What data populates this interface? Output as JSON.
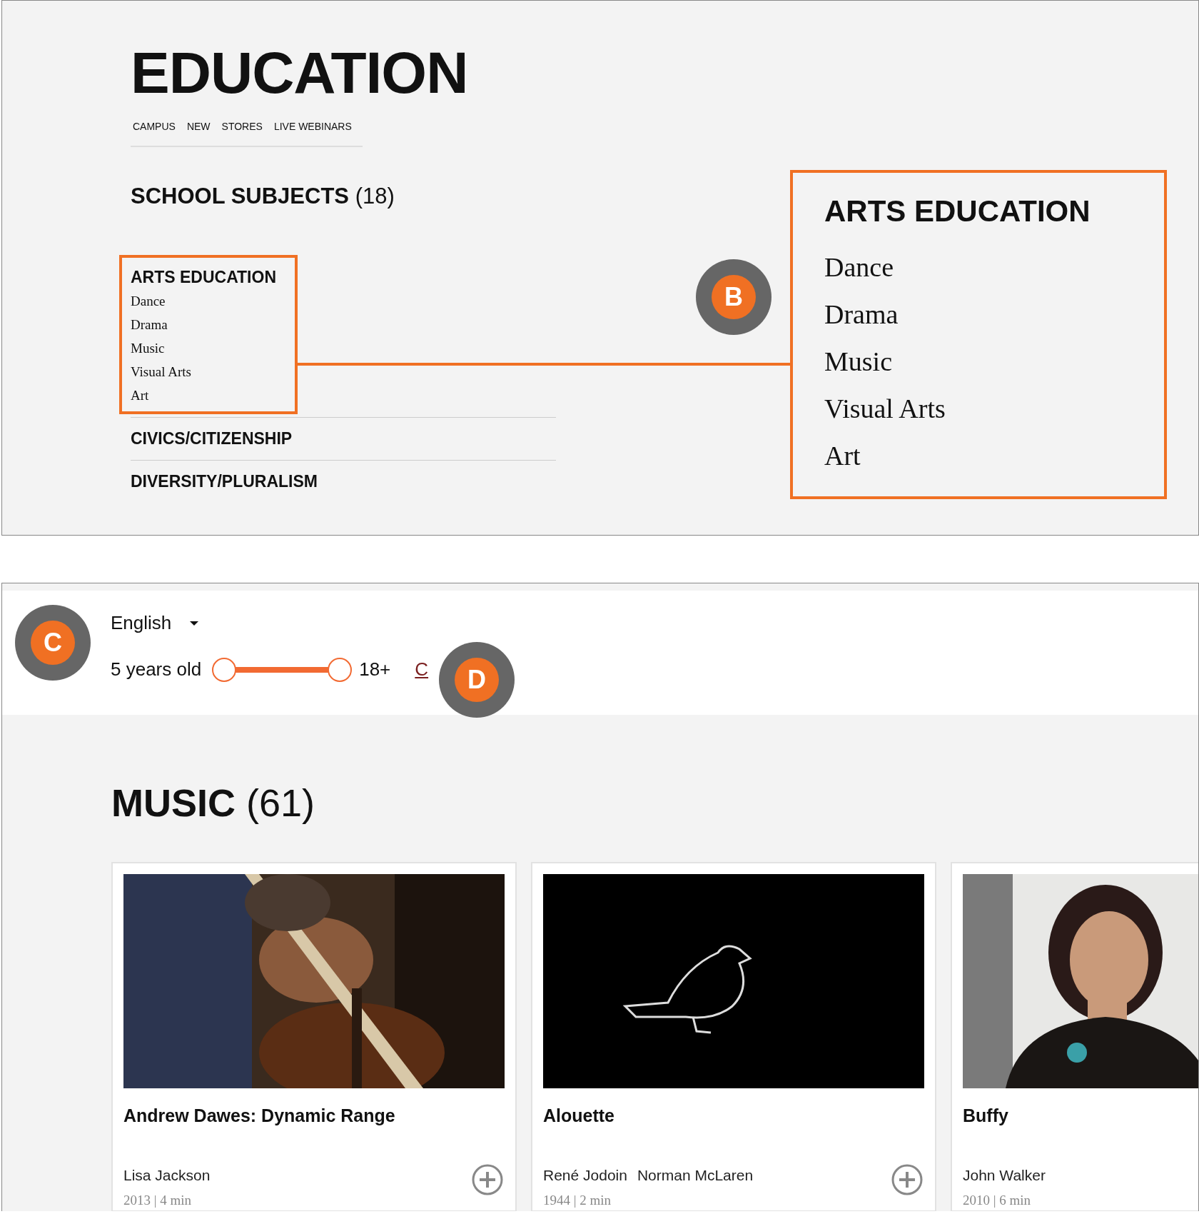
{
  "header": {
    "title": "EDUCATION",
    "nav": [
      {
        "label": "CAMPUS"
      },
      {
        "label": "NEW"
      },
      {
        "label": "STORES"
      },
      {
        "label": "LIVE WEBINARS"
      }
    ]
  },
  "subjects": {
    "title": "SCHOOL SUBJECTS",
    "count": "(18)",
    "categories": [
      {
        "title": "ARTS EDUCATION",
        "highlighted": true,
        "items": [
          "Dance",
          "Drama",
          "Music",
          "Visual Arts",
          "Art"
        ]
      },
      {
        "title": "CIVICS/CITIZENSHIP",
        "highlighted": false
      },
      {
        "title": "DIVERSITY/PLURALISM",
        "highlighted": false
      }
    ]
  },
  "callout": {
    "badge": "B",
    "title": "ARTS EDUCATION",
    "items": [
      "Dance",
      "Drama",
      "Music",
      "Visual Arts",
      "Art"
    ]
  },
  "filters": {
    "badge": "C",
    "language": "English",
    "min_label": "5 years old",
    "max_label": "18+",
    "thumbs": [
      {
        "level": 0
      },
      {
        "level": 1
      }
    ],
    "reset": "C",
    "badge_2": "D"
  },
  "section": {
    "title": "MUSIC",
    "count": "(61)",
    "cards": [
      {
        "title": "Andrew Dawes: Dynamic Range",
        "authors": [
          "Lisa Jackson"
        ],
        "meta": "2013 | 4 min"
      },
      {
        "title": "Alouette",
        "authors": [
          "René Jodoin",
          "Norman McLaren"
        ],
        "meta": "1944 | 2 min"
      },
      {
        "title": "Buffy",
        "authors": [
          "John Walker"
        ],
        "meta": "2010 | 6 min"
      }
    ]
  }
}
